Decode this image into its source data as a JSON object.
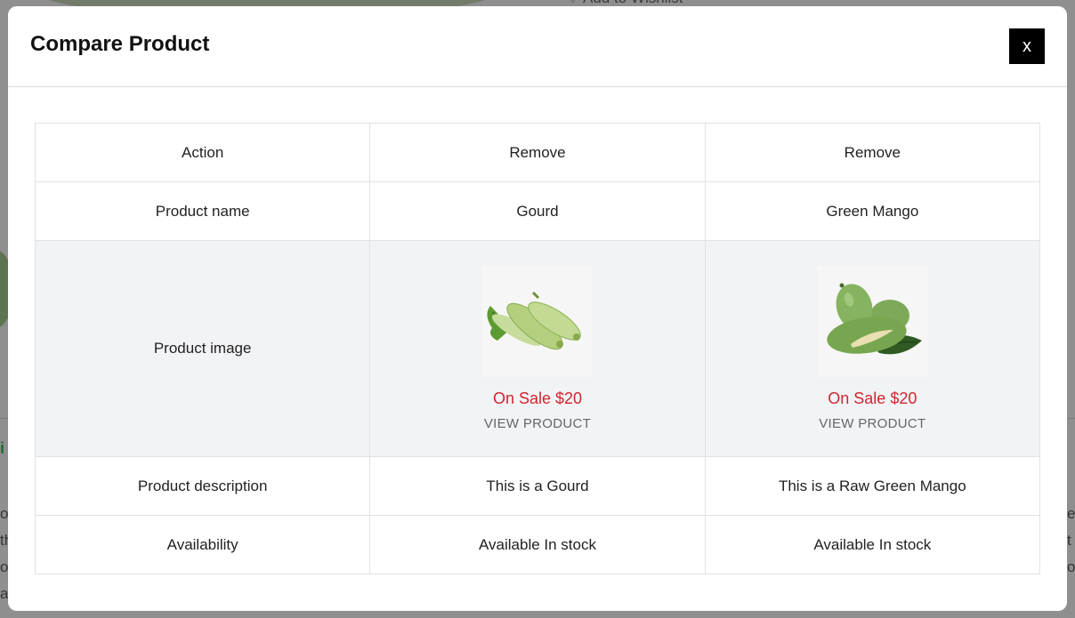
{
  "background": {
    "wishlist_fragment": "♡ Add to Wishlist",
    "left_fragment": "i",
    "left_text": "os th o as",
    "right_text": "e t o"
  },
  "modal": {
    "title": "Compare Product",
    "close_label": "x"
  },
  "table": {
    "labels": {
      "action": "Action",
      "name": "Product name",
      "image": "Product image",
      "description": "Product description",
      "availability": "Availability"
    },
    "products": [
      {
        "action": "Remove",
        "name": "Gourd",
        "sale": "On Sale $20",
        "view": "VIEW PRODUCT",
        "description": "This is a Gourd",
        "availability": "Available In stock"
      },
      {
        "action": "Remove",
        "name": "Green Mango",
        "sale": "On Sale $20",
        "view": "VIEW PRODUCT",
        "description": "This is a Raw Green Mango",
        "availability": "Available In stock"
      }
    ]
  },
  "colors": {
    "sale": "#d0262f",
    "close_bg": "#000000",
    "image_row_bg": "#f2f3f5"
  }
}
